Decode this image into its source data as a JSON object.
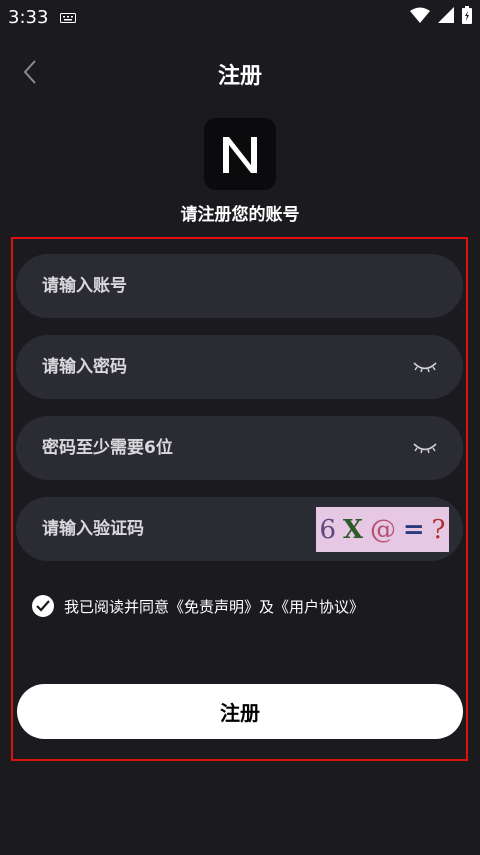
{
  "status_bar": {
    "time": "3:33"
  },
  "header": {
    "title": "注册"
  },
  "brand": {
    "subtitle": "请注册您的账号"
  },
  "form": {
    "account_placeholder": "请输入账号",
    "password_placeholder": "请输入密码",
    "confirm_placeholder": "密码至少需要6位",
    "captcha_placeholder": "请输入验证码",
    "captcha_text": [
      "6",
      "X",
      "@",
      "=",
      "?"
    ],
    "agreement_text": "我已阅读并同意《免责声明》及《用户协议》",
    "submit_label": "注册"
  },
  "colors": {
    "background": "#1b1b1f",
    "field": "#2b2c33",
    "highlight_frame": "#e01010",
    "captcha_bg": "#e6c7e4"
  },
  "icons": [
    "back-arrow-icon",
    "keyboard-icon",
    "wifi-icon",
    "signal-icon",
    "battery-icon",
    "eye-closed-icon",
    "check-icon"
  ]
}
